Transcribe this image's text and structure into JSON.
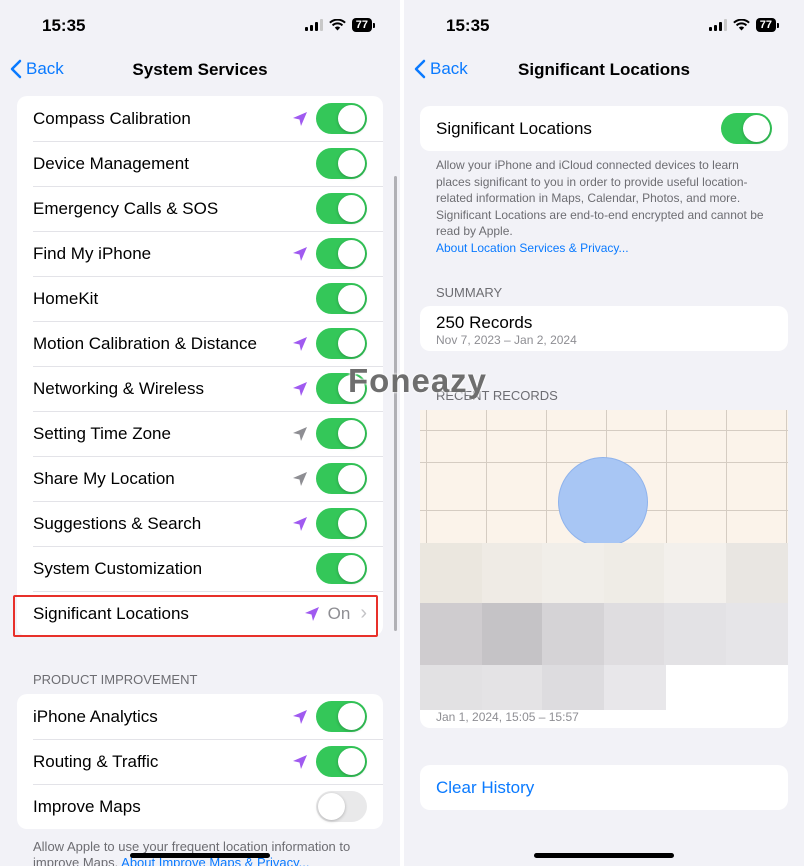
{
  "left": {
    "status": {
      "time": "15:35",
      "battery": "77"
    },
    "nav": {
      "back_label": "Back",
      "title": "System Services"
    },
    "items": [
      {
        "label": "Compass Calibration",
        "arrow": "purple",
        "toggle": "on"
      },
      {
        "label": "Device Management",
        "arrow": "",
        "toggle": "on"
      },
      {
        "label": "Emergency Calls & SOS",
        "arrow": "",
        "toggle": "on"
      },
      {
        "label": "Find My iPhone",
        "arrow": "purple",
        "toggle": "on"
      },
      {
        "label": "HomeKit",
        "arrow": "",
        "toggle": "on"
      },
      {
        "label": "Motion Calibration & Distance",
        "arrow": "purple",
        "toggle": "on"
      },
      {
        "label": "Networking & Wireless",
        "arrow": "purple",
        "toggle": "on"
      },
      {
        "label": "Setting Time Zone",
        "arrow": "gray",
        "toggle": "on"
      },
      {
        "label": "Share My Location",
        "arrow": "gray",
        "toggle": "on"
      },
      {
        "label": "Suggestions & Search",
        "arrow": "purple",
        "toggle": "on"
      },
      {
        "label": "System Customization",
        "arrow": "",
        "toggle": "on"
      },
      {
        "label": "Significant Locations",
        "arrow": "purple",
        "value": "On"
      }
    ],
    "product_improvement": {
      "header": "PRODUCT IMPROVEMENT",
      "items": [
        {
          "label": "iPhone Analytics",
          "arrow": "purple",
          "toggle": "on"
        },
        {
          "label": "Routing & Traffic",
          "arrow": "purple",
          "toggle": "on"
        },
        {
          "label": "Improve Maps",
          "arrow": "",
          "toggle": "off"
        }
      ],
      "footer": "Allow Apple to use your frequent location information to improve Maps.",
      "footer_link": "About Improve Maps & Privacy..."
    }
  },
  "right": {
    "status": {
      "time": "15:35",
      "battery": "77"
    },
    "nav": {
      "back_label": "Back",
      "title": "Significant Locations"
    },
    "toggle_label": "Significant Locations",
    "toggle_state": "on",
    "description": "Allow your iPhone and iCloud connected devices to learn places significant to you in order to provide useful location-related information in Maps, Calendar, Photos, and more. Significant Locations are end-to-end encrypted and cannot be read by Apple.",
    "description_link": "About Location Services & Privacy...",
    "summary_header": "SUMMARY",
    "summary_title": "250 Records",
    "summary_dates": "Nov 7, 2023 – Jan 2, 2024",
    "recent_header": "RECENT RECORDS",
    "recent_time": "Jan 1, 2024, 15:05 – 15:57",
    "clear_history": "Clear History"
  },
  "watermark": "Foneazy",
  "colors": {
    "accent": "#0a7aff",
    "toggle_on": "#34c759",
    "location_purple": "#a05af0",
    "location_gray": "#8e8e93",
    "highlight": "#e8302a"
  }
}
